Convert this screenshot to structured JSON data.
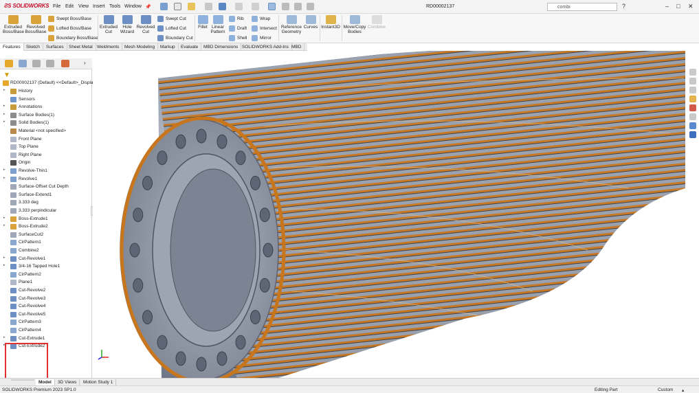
{
  "app": {
    "brand": "SOLIDWORKS",
    "document_title": "RD00002137"
  },
  "menu": [
    "File",
    "Edit",
    "View",
    "Insert",
    "Tools",
    "Window"
  ],
  "search": {
    "value": "combi"
  },
  "ribbon": {
    "extruded_boss": "Extruded Boss/Base",
    "revolved_boss": "Revolved Boss/Base",
    "swept_boss": "Swept Boss/Base",
    "lofted_boss": "Lofted Boss/Base",
    "boundary_boss": "Boundary Boss/Base",
    "extruded_cut": "Extruded Cut",
    "hole_wizard": "Hole Wizard",
    "revolved_cut": "Revolved Cut",
    "swept_cut": "Swept Cut",
    "lofted_cut": "Lofted Cut",
    "boundary_cut": "Boundary Cut",
    "fillet": "Fillet",
    "linear_pattern": "Linear Pattern",
    "rib": "Rib",
    "draft": "Draft",
    "shell": "Shell",
    "wrap": "Wrap",
    "intersect": "Intersect",
    "mirror": "Mirror",
    "reference_geometry": "Reference Geometry",
    "curves": "Curves",
    "instant3d": "Instant3D",
    "move_copy": "Move/Copy Bodies",
    "combine": "Combine"
  },
  "command_tabs": [
    "Features",
    "Sketch",
    "Surfaces",
    "Sheet Metal",
    "Weldments",
    "Mesh Modeling",
    "Markup",
    "Evaluate",
    "MBD Dimensions",
    "SOLIDWORKS Add-Ins",
    "MBD"
  ],
  "tree": {
    "root": "RD00002137 (Default) <<Default>_Display",
    "items": [
      {
        "label": "History",
        "exp": true
      },
      {
        "label": "Sensors",
        "exp": false
      },
      {
        "label": "Annotations",
        "exp": true
      },
      {
        "label": "Surface Bodies(1)",
        "exp": true
      },
      {
        "label": "Solid Bodies(1)",
        "exp": true
      },
      {
        "label": "Material <not specified>",
        "exp": false
      },
      {
        "label": "Front Plane",
        "exp": false
      },
      {
        "label": "Top Plane",
        "exp": false
      },
      {
        "label": "Right Plane",
        "exp": false
      },
      {
        "label": "Origin",
        "exp": false
      },
      {
        "label": "Revolve-Thin1",
        "exp": true
      },
      {
        "label": "Revolve1",
        "exp": true
      },
      {
        "label": "Surface-Offset Cut Depth",
        "exp": false
      },
      {
        "label": "Surface-Extend1",
        "exp": false
      },
      {
        "label": "3.333 deg",
        "exp": false
      },
      {
        "label": "3.333 perpindicular",
        "exp": false
      },
      {
        "label": "Boss-Extrude1",
        "exp": true
      },
      {
        "label": "Boss-Extrude2",
        "exp": true
      },
      {
        "label": "SurfaceCut2",
        "exp": false
      },
      {
        "label": "CirPattern1",
        "exp": false
      },
      {
        "label": "Combine2",
        "exp": false
      },
      {
        "label": "Cut-Revolve1",
        "exp": true
      },
      {
        "label": "3/4-16 Tapped Hole1",
        "exp": true
      },
      {
        "label": "CirPattern2",
        "exp": false
      },
      {
        "label": "Plane1",
        "exp": false
      },
      {
        "label": "Cut-Revolve2",
        "exp": false
      },
      {
        "label": "Cut-Revolve3",
        "exp": false
      },
      {
        "label": "Cut-Revolve4",
        "exp": false
      },
      {
        "label": "Cut-Revolve5",
        "exp": false
      },
      {
        "label": "CirPattern3",
        "exp": false
      },
      {
        "label": "CirPattern4",
        "exp": false
      },
      {
        "label": "Cut-Extrude1",
        "exp": true
      },
      {
        "label": "Cut-Extrude2",
        "exp": true
      }
    ]
  },
  "bottom_tabs": [
    "Model",
    "3D Views",
    "Motion Study 1"
  ],
  "status": {
    "version": "SOLIDWORKS Premium 2023 SP1.0",
    "mode": "Editing Part",
    "units": "Custom"
  },
  "colors": {
    "accent": "#2f7fd8",
    "copper": "#c8761e",
    "steel": "#9aa1ae",
    "highlight": "#e03030"
  }
}
